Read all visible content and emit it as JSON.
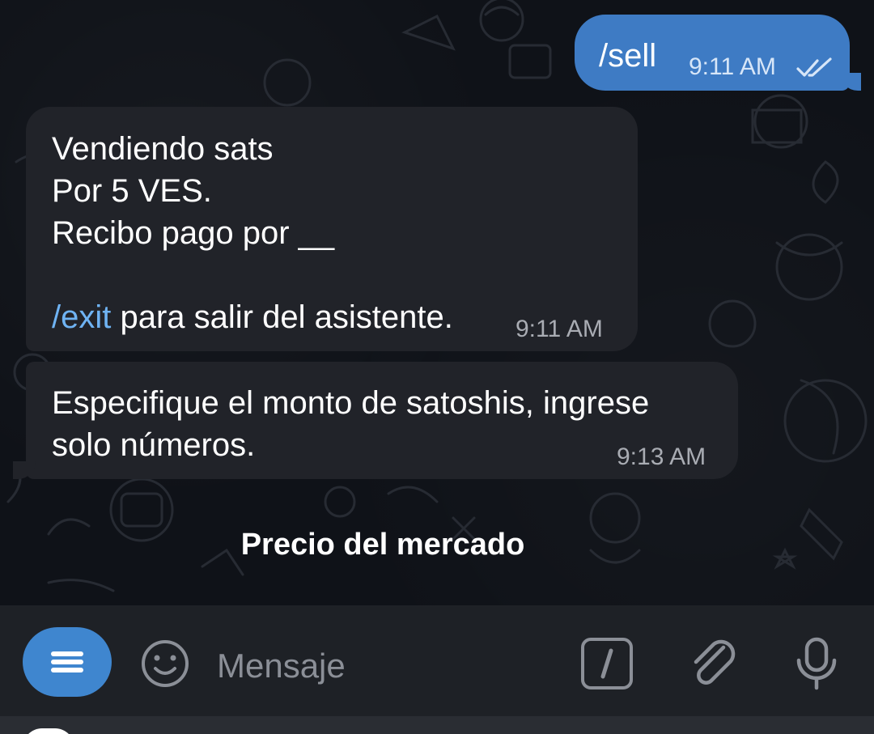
{
  "chat": {
    "outgoing": {
      "text": "/sell",
      "time": "9:11 AM",
      "status_icon": "double-check-icon"
    },
    "incoming_1": {
      "lines": [
        "Vendiendo sats",
        "Por 5 VES.",
        "Recibo pago por __"
      ],
      "command": "/exit",
      "command_suffix": " para salir del asistente.",
      "time": "9:11 AM"
    },
    "incoming_2": {
      "lines": [
        "Especifique el monto de satoshis, ingrese",
        "solo números."
      ],
      "time": "9:13 AM"
    }
  },
  "keyboard": {
    "button_label": "Precio del mercado"
  },
  "input": {
    "placeholder": "Mensaje",
    "menu_icon": "menu-icon",
    "emoji_icon": "smile-icon",
    "commands_icon": "slash-command-icon",
    "attach_icon": "paperclip-icon",
    "mic_icon": "microphone-icon"
  },
  "colors": {
    "outgoing_bubble": "#3e7bc4",
    "incoming_bubble": "#212329",
    "link": "#6fb3f3",
    "accent": "#3f86cf"
  }
}
